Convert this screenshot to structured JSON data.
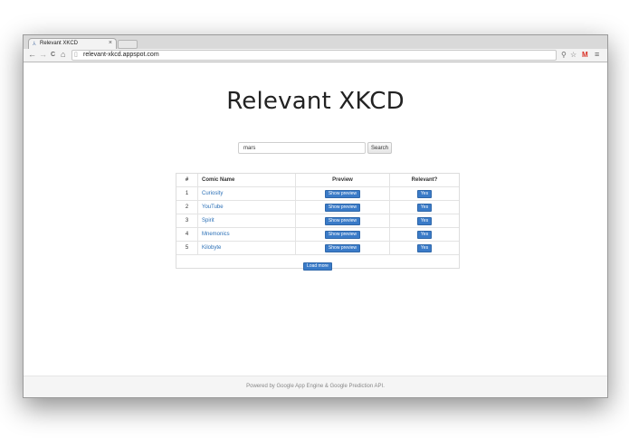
{
  "browser": {
    "tab_title": "Relevant XKCD",
    "tab_close": "×",
    "url": "relevant-xkcd.appspot.com",
    "icons": {
      "back": "←",
      "forward": "→",
      "reload": "C",
      "home": "⌂",
      "page": "▯",
      "search": "⚲",
      "star": "☆",
      "gmail": "M",
      "menu": "≡",
      "favicon": "⅄"
    }
  },
  "page": {
    "title": "Relevant XKCD",
    "search": {
      "value": "mars",
      "button": "Search"
    },
    "table": {
      "headers": [
        "#",
        "Comic Name",
        "Preview",
        "Relevant?"
      ],
      "rows": [
        {
          "num": "1",
          "name": "Curiosity",
          "preview": "Show preview",
          "relevant": "Yes"
        },
        {
          "num": "2",
          "name": "YouTube",
          "preview": "Show preview",
          "relevant": "Yes"
        },
        {
          "num": "3",
          "name": "Spirit",
          "preview": "Show preview",
          "relevant": "Yes"
        },
        {
          "num": "4",
          "name": "Mnemonics",
          "preview": "Show preview",
          "relevant": "Yes"
        },
        {
          "num": "5",
          "name": "Kilobyte",
          "preview": "Show preview",
          "relevant": "Yes"
        }
      ],
      "load_more": "Load more"
    },
    "footer": "Powered by Google App Engine & Google Prediction API."
  },
  "colors": {
    "link": "#2a6fb6",
    "button_primary": "#3a7bc8"
  }
}
